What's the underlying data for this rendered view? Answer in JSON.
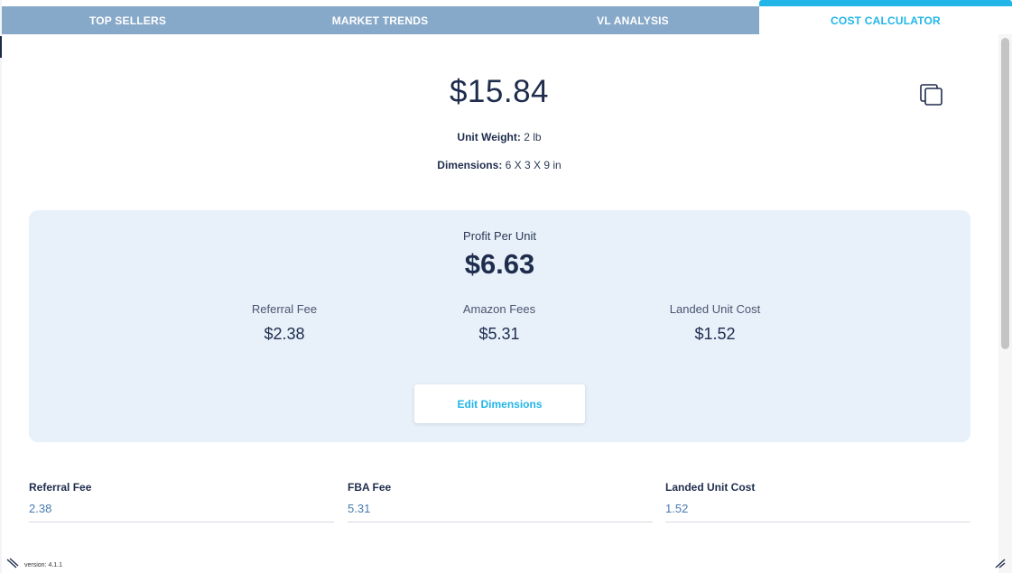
{
  "tabs": [
    {
      "label": "TOP SELLERS"
    },
    {
      "label": "MARKET TRENDS"
    },
    {
      "label": "VL ANALYSIS"
    },
    {
      "label": "COST CALCULATOR",
      "active": true
    }
  ],
  "product": {
    "price": "$15.84",
    "weight_label": "Unit Weight:",
    "weight_value": "2 lb",
    "dimensions_label": "Dimensions:",
    "dimensions_value": "6 X 3 X 9 in"
  },
  "profit": {
    "label": "Profit Per Unit",
    "value": "$6.63",
    "stats": [
      {
        "label": "Referral Fee",
        "value": "$2.38"
      },
      {
        "label": "Amazon Fees",
        "value": "$5.31"
      },
      {
        "label": "Landed Unit Cost",
        "value": "$1.52"
      }
    ],
    "edit_button": "Edit Dimensions"
  },
  "fields": [
    {
      "label": "Referral Fee",
      "value": "2.38"
    },
    {
      "label": "FBA Fee",
      "value": "5.31"
    },
    {
      "label": "Landed Unit Cost",
      "value": "1.52"
    }
  ],
  "footer": {
    "version": "version: 4.1.1"
  },
  "colors": {
    "tab_bar": "#87a9c9",
    "accent": "#22b5e8",
    "panel_bg": "#e8f0fa",
    "text_dark": "#1f2d4d"
  },
  "icons": {
    "copy": "copy-icon",
    "resize_left": "resize-handle-icon",
    "resize_right": "resize-handle-icon"
  }
}
